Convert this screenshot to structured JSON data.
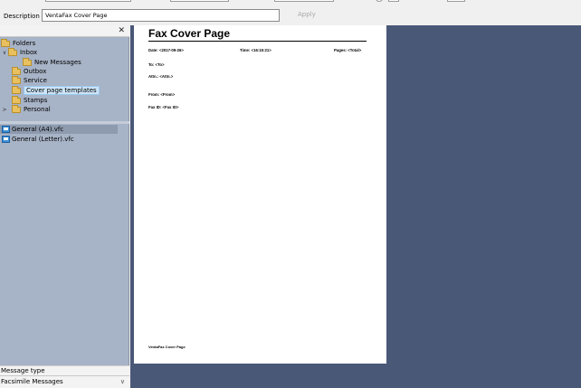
{
  "description": {
    "label": "Description",
    "value": "VentaFax Cover Page",
    "apply_label": "Apply"
  },
  "tree": {
    "items": [
      {
        "label": "Folders",
        "expander": "",
        "indent": 0
      },
      {
        "label": "Inbox",
        "expander": "∨",
        "indent": 1
      },
      {
        "label": "New Messages",
        "expander": "",
        "indent": 2
      },
      {
        "label": "Outbox",
        "expander": "",
        "indent": 1
      },
      {
        "label": "Service",
        "expander": "",
        "indent": 1
      },
      {
        "label": "Cover page templates",
        "expander": "",
        "indent": 1,
        "selected": true
      },
      {
        "label": "Stamps",
        "expander": "",
        "indent": 1
      },
      {
        "label": "Personal",
        "expander": ">",
        "indent": 1
      }
    ]
  },
  "files": [
    {
      "label": "General (A4).vfc",
      "selected": true
    },
    {
      "label": "General (Letter).vfc",
      "selected": false
    }
  ],
  "message_type": {
    "label": "Message type",
    "value": "Facsimile Messages"
  },
  "cover_page": {
    "title": "Fax Cover Page",
    "date": "Date: <2017-09-26>",
    "time": "Time: <16:15:21>",
    "pages": "Pages: <Total>",
    "to": "To: <To>",
    "attn": "Attn.: <Attn.>",
    "from": "From: <From>",
    "fax_id": "Fax ID: <Fax ID>",
    "footer": "VentaFax Cover Page"
  },
  "colors": {
    "left_pane_bg": "#a7b3c6",
    "preview_bg": "#4a5878",
    "selection": "#cce4f7"
  }
}
